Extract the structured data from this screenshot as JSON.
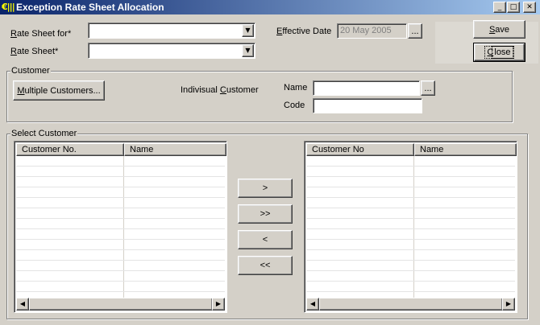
{
  "window": {
    "title": "Exception Rate Sheet Allocation",
    "icon_glyph": "€|||",
    "min_glyph": "_",
    "max_glyph": "□",
    "close_glyph": "✕"
  },
  "form": {
    "rate_sheet_for_label_u": "R",
    "rate_sheet_for_label_rest": "ate Sheet for*",
    "rate_sheet_for_value": "",
    "rate_sheet_label_u": "R",
    "rate_sheet_label_rest": "ate Sheet*",
    "rate_sheet_value": "",
    "effective_date_label_u": "E",
    "effective_date_label_rest": "ffective Date",
    "effective_date_value": "20 May 2005",
    "ellipsis": "..."
  },
  "actions": {
    "save_u": "S",
    "save_rest": "ave",
    "close_u": "C",
    "close_rest": "lose"
  },
  "customer_group": {
    "legend": "Customer",
    "multiple_u": "M",
    "multiple_rest": "ultiple Customers...",
    "individual_label_pre": "Indivisual ",
    "individual_label_u": "C",
    "individual_label_rest": "ustomer",
    "name_label": "Name",
    "name_value": "",
    "code_label": "Code",
    "code_value": "",
    "ellipsis": "..."
  },
  "select_group": {
    "legend": "Select Customer",
    "left_columns": [
      "Customer No.",
      "Name"
    ],
    "right_columns": [
      "Customer No",
      "Name"
    ],
    "move_one_right": ">",
    "move_all_right": ">>",
    "move_one_left": "<",
    "move_all_left": "<<"
  },
  "glyphs": {
    "dropdown": "▼",
    "scroll_left": "◀",
    "scroll_right": "▶"
  }
}
